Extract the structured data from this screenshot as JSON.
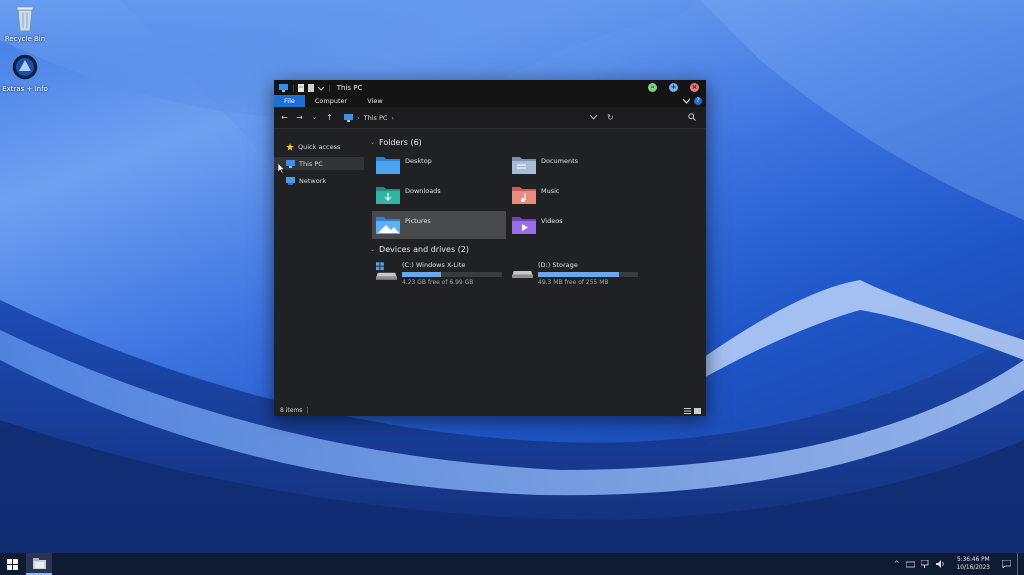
{
  "desktop": {
    "icons": [
      {
        "label": "Recycle Bin",
        "icon": "recycle-bin-icon"
      },
      {
        "label": "Extras + Info",
        "icon": "extras-info-icon"
      }
    ]
  },
  "window": {
    "title": "This PC",
    "ribbon_tabs": [
      {
        "label": "File",
        "active": true
      },
      {
        "label": "Computer",
        "active": false
      },
      {
        "label": "View",
        "active": false
      }
    ],
    "address": {
      "crumb": "This PC"
    },
    "sidebar": [
      {
        "label": "Quick access",
        "icon": "star-icon",
        "selected": false
      },
      {
        "label": "This PC",
        "icon": "computer-icon",
        "selected": true
      },
      {
        "label": "Network",
        "icon": "network-icon",
        "selected": false
      }
    ],
    "folders_header": "Folders (6)",
    "folders": [
      {
        "label": "Desktop",
        "icon": "desktop-folder-icon",
        "color": "#3c8fe0"
      },
      {
        "label": "Documents",
        "icon": "documents-folder-icon",
        "color": "#8aa6c9"
      },
      {
        "label": "Downloads",
        "icon": "downloads-folder-icon",
        "color": "#2aa79b"
      },
      {
        "label": "Music",
        "icon": "music-folder-icon",
        "color": "#e0786c"
      },
      {
        "label": "Pictures",
        "icon": "pictures-folder-icon",
        "color": "#3c8fe0",
        "selected": true
      },
      {
        "label": "Videos",
        "icon": "videos-folder-icon",
        "color": "#8b5fd6"
      }
    ],
    "drives_header": "Devices and drives (2)",
    "drives": [
      {
        "label": "(C:) Windows X-Lite",
        "free": "4.23 GB free of 6.99 GB",
        "used_fraction": 0.39,
        "icon": "system-drive-icon"
      },
      {
        "label": "(D:) Storage",
        "free": "49.3 MB free of 255 MB",
        "used_fraction": 0.81,
        "icon": "storage-drive-icon"
      }
    ],
    "status": {
      "items": "8 items"
    }
  },
  "taskbar": {
    "clock_time": "5:36:46 PM",
    "clock_date": "10/16/2023"
  },
  "colors": {
    "accent": "#1d6fd6",
    "bar": "#6aa9f0"
  }
}
